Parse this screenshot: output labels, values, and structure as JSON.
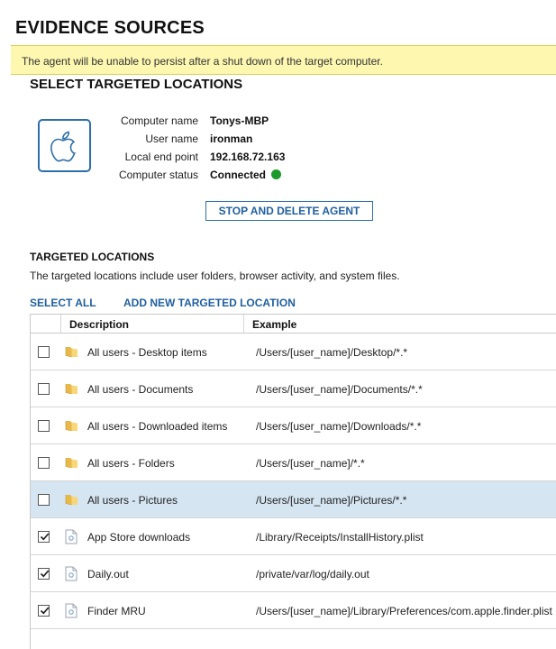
{
  "page_title": "EVIDENCE SOURCES",
  "warning": "The agent will be unable to persist after a shut down of the target computer.",
  "section_title": "SELECT TARGETED LOCATIONS",
  "device": {
    "icon": "apple-logo-icon",
    "fields": [
      {
        "label": "Computer name",
        "value": "Tonys-MBP"
      },
      {
        "label": "User name",
        "value": "ironman"
      },
      {
        "label": "Local end point",
        "value": "192.168.72.163"
      },
      {
        "label": "Computer status",
        "value": "Connected"
      }
    ],
    "status_color": "#1a9a2a"
  },
  "stop_button": "STOP AND DELETE AGENT",
  "targeted": {
    "title": "TARGETED LOCATIONS",
    "description": "The targeted locations include user folders, browser activity, and system files.",
    "select_all": "SELECT ALL",
    "add_new": "ADD NEW TARGETED LOCATION"
  },
  "table": {
    "headers": {
      "description": "Description",
      "example": "Example"
    },
    "rows": [
      {
        "checked": false,
        "icon": "folder-icon",
        "description": "All users - Desktop items",
        "example": "/Users/[user_name]/Desktop/*.*",
        "selected": false
      },
      {
        "checked": false,
        "icon": "folder-icon",
        "description": "All users - Documents",
        "example": "/Users/[user_name]/Documents/*.*",
        "selected": false
      },
      {
        "checked": false,
        "icon": "folder-icon",
        "description": "All users - Downloaded items",
        "example": "/Users/[user_name]/Downloads/*.*",
        "selected": false
      },
      {
        "checked": false,
        "icon": "folder-icon",
        "description": "All users - Folders",
        "example": "/Users/[user_name]/*.*",
        "selected": false
      },
      {
        "checked": false,
        "icon": "folder-icon",
        "description": "All users - Pictures",
        "example": "/Users/[user_name]/Pictures/*.*",
        "selected": true
      },
      {
        "checked": true,
        "icon": "file-icon",
        "description": "App Store downloads",
        "example": "/Library/Receipts/InstallHistory.plist",
        "selected": false
      },
      {
        "checked": true,
        "icon": "file-icon",
        "description": "Daily.out",
        "example": "/private/var/log/daily.out",
        "selected": false
      },
      {
        "checked": true,
        "icon": "file-icon",
        "description": "Finder MRU",
        "example": "/Users/[user_name]/Library/Preferences/com.apple.finder.plist",
        "selected": false
      }
    ]
  },
  "colors": {
    "accent": "#1f5f9e",
    "warning_bg": "#fdf7b0",
    "selected_row": "#d5e5f2"
  }
}
